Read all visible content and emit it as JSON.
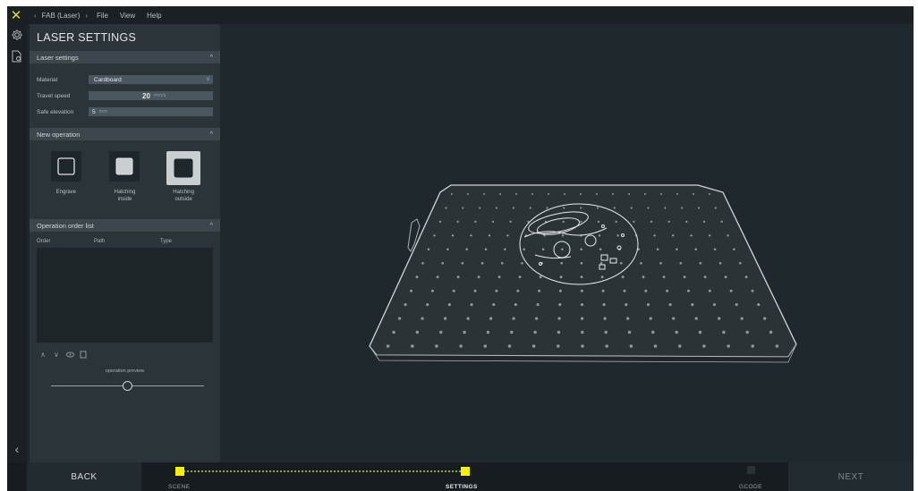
{
  "topbar": {
    "breadcrumb_back": "‹",
    "breadcrumb_label": "FAB (Laser)",
    "breadcrumb_forward": "›",
    "menu": [
      "File",
      "View",
      "Help"
    ]
  },
  "panel": {
    "title": "LASER SETTINGS",
    "laser_settings": {
      "header": "Laser settings",
      "material_label": "Material",
      "material_value": "Cardboard",
      "travel_speed_label": "Travel speed",
      "travel_speed_value": "20",
      "travel_speed_unit": "mm/s",
      "safe_elevation_label": "Safe elevation",
      "safe_elevation_value": "5",
      "safe_elevation_unit": "mm"
    },
    "new_operation": {
      "header": "New operation",
      "ops": [
        {
          "label": "Engrave"
        },
        {
          "label": "Hatching inside"
        },
        {
          "label": "Hatching outside"
        }
      ]
    },
    "operation_list": {
      "header": "Operation order list",
      "columns": [
        "Order",
        "Path",
        "Type"
      ],
      "preview_label": "operation preview",
      "preview_level": 0.5
    }
  },
  "bottombar": {
    "back_label": "BACK",
    "next_label": "NEXT",
    "steps": [
      "SCENE",
      "SETTINGS",
      "GCODE"
    ],
    "active_step": "SETTINGS",
    "accent": "#f5f000"
  },
  "colors": {
    "accent": "#d8e02a",
    "panel": "#2a3439",
    "viewport": "#1f282c"
  }
}
